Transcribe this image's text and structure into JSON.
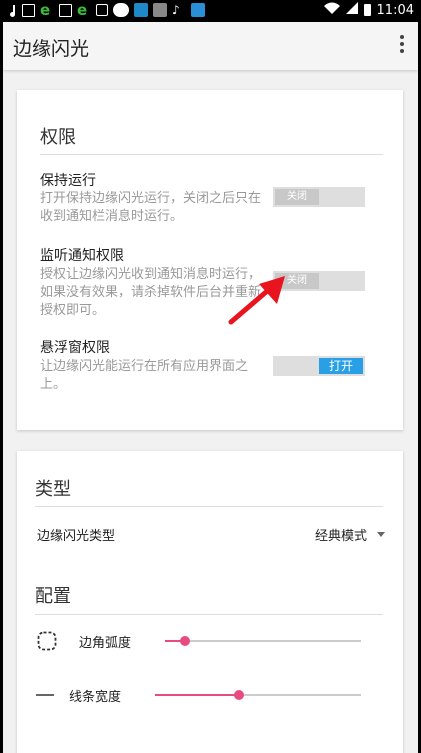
{
  "status_bar": {
    "time": "11:04"
  },
  "app_bar": {
    "title": "边缘闪光"
  },
  "permissions": {
    "heading": "权限",
    "keep_running": {
      "title": "保持运行",
      "desc": "打开保持边缘闪光运行，关闭之后只在收到通知栏消息时运行。",
      "toggle": "关闭"
    },
    "notification": {
      "title": "监听通知权限",
      "desc": "授权让边缘闪光收到通知消息时运行，如果没有效果，请杀掉软件后台并重新授权即可。",
      "toggle": "关闭"
    },
    "overlay": {
      "title": "悬浮窗权限",
      "desc": "让边缘闪光能运行在所有应用界面之上。",
      "toggle": "打开"
    }
  },
  "type_section": {
    "heading": "类型",
    "label": "边缘闪光类型",
    "value": "经典模式"
  },
  "config_section": {
    "heading": "配置",
    "corner": {
      "label": "边角弧度",
      "value": 0.1
    },
    "line": {
      "label": "线条宽度",
      "value": 0.41
    }
  },
  "colors": {
    "accent": "#e84b7d",
    "toggle_on": "#29a0e6",
    "arrow": "#e8141e"
  }
}
